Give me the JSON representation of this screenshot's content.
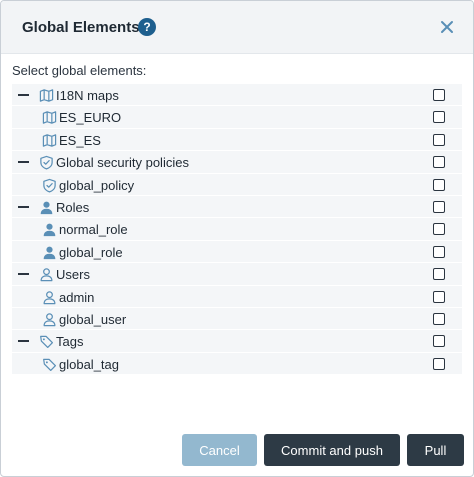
{
  "dialog": {
    "title": "Global Elements",
    "help_glyph": "?",
    "close_icon": "close-icon",
    "prompt": "Select global elements:"
  },
  "tree": [
    {
      "label": "I18N maps",
      "level": 0,
      "icon": "map-icon",
      "collapsible": true,
      "checked": false
    },
    {
      "label": "ES_EURO",
      "level": 1,
      "icon": "map-icon",
      "collapsible": false,
      "checked": false
    },
    {
      "label": "ES_ES",
      "level": 1,
      "icon": "map-icon",
      "collapsible": false,
      "checked": false
    },
    {
      "label": "Global security policies",
      "level": 0,
      "icon": "shield-icon",
      "collapsible": true,
      "checked": false
    },
    {
      "label": "global_policy",
      "level": 1,
      "icon": "shield-icon",
      "collapsible": false,
      "checked": false
    },
    {
      "label": "Roles",
      "level": 0,
      "icon": "role-icon",
      "collapsible": true,
      "checked": false
    },
    {
      "label": "normal_role",
      "level": 1,
      "icon": "role-icon",
      "collapsible": false,
      "checked": false
    },
    {
      "label": "global_role",
      "level": 1,
      "icon": "role-icon",
      "collapsible": false,
      "checked": false
    },
    {
      "label": "Users",
      "level": 0,
      "icon": "user-icon",
      "collapsible": true,
      "checked": false
    },
    {
      "label": "admin",
      "level": 1,
      "icon": "user-icon",
      "collapsible": false,
      "checked": false
    },
    {
      "label": "global_user",
      "level": 1,
      "icon": "user-icon",
      "collapsible": false,
      "checked": false
    },
    {
      "label": "Tags",
      "level": 0,
      "icon": "tag-icon",
      "collapsible": true,
      "checked": false
    },
    {
      "label": "global_tag",
      "level": 1,
      "icon": "tag-icon",
      "collapsible": false,
      "checked": false
    }
  ],
  "buttons": {
    "cancel": "Cancel",
    "commit": "Commit and push",
    "pull": "Pull"
  },
  "colors": {
    "accent": "#1e5f8e",
    "icon": "#5a8fb6",
    "dark_button": "#2d3a45",
    "disabled_button": "#93b8cf"
  }
}
